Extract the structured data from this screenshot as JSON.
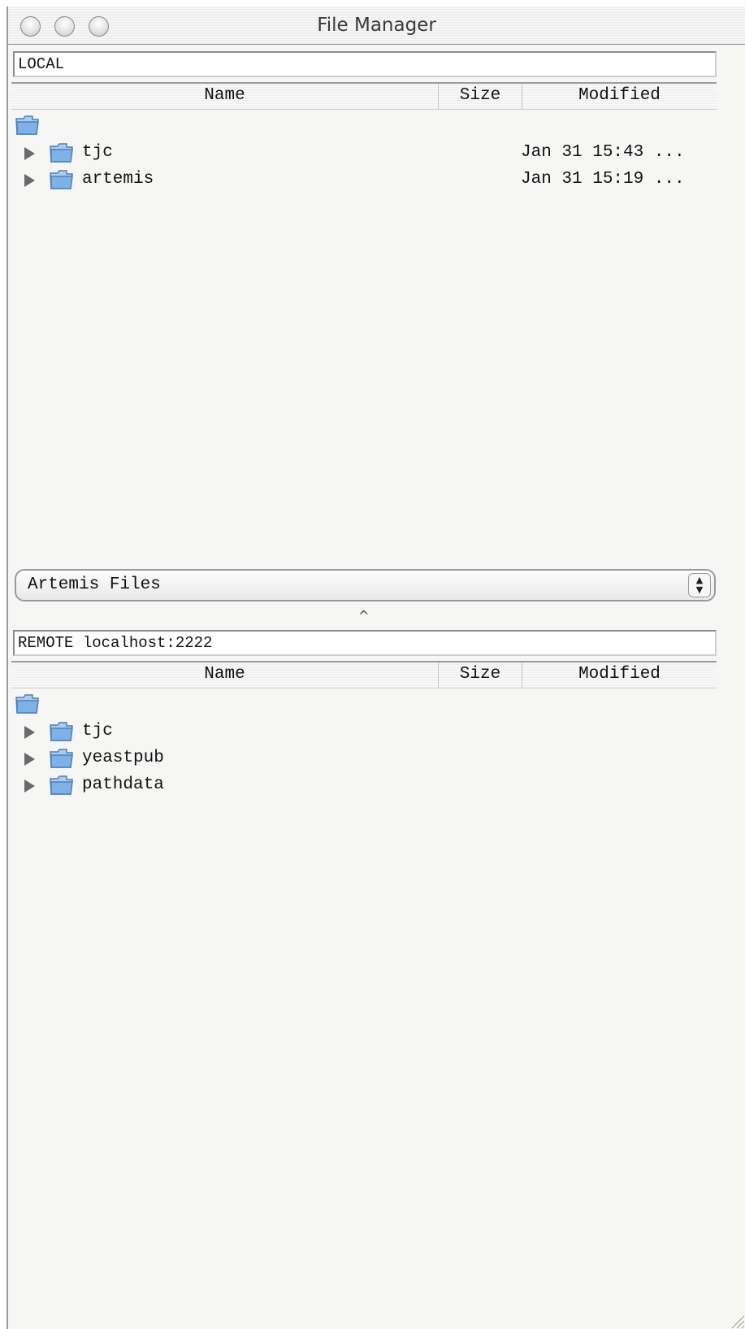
{
  "window": {
    "title": "File Manager"
  },
  "local": {
    "location": "LOCAL",
    "columns": {
      "name": "Name",
      "size": "Size",
      "modified": "Modified"
    },
    "items": [
      {
        "name": "tjc",
        "modified": "Jan 31 15:43 ..."
      },
      {
        "name": "artemis",
        "modified": "Jan 31 15:19 ..."
      }
    ]
  },
  "selector": {
    "value": "Artemis Files"
  },
  "divider": {
    "handle_glyph": "^"
  },
  "remote": {
    "location": "REMOTE localhost:2222",
    "columns": {
      "name": "Name",
      "size": "Size",
      "modified": "Modified"
    },
    "items": [
      {
        "name": "tjc"
      },
      {
        "name": "yeastpub"
      },
      {
        "name": "pathdata"
      }
    ]
  },
  "icons": {
    "close": "close-button-icon",
    "minimize": "minimize-button-icon",
    "zoom": "zoom-button-icon",
    "folder": "folder-icon",
    "disclosure": "disclosure-triangle-icon",
    "stepper": "stepper-arrows-icon",
    "resize": "resize-grip-icon"
  },
  "colors": {
    "window_bg": "#f6f7f5",
    "folder_blue": "#7fb0e6",
    "border": "#8d8d8d"
  }
}
